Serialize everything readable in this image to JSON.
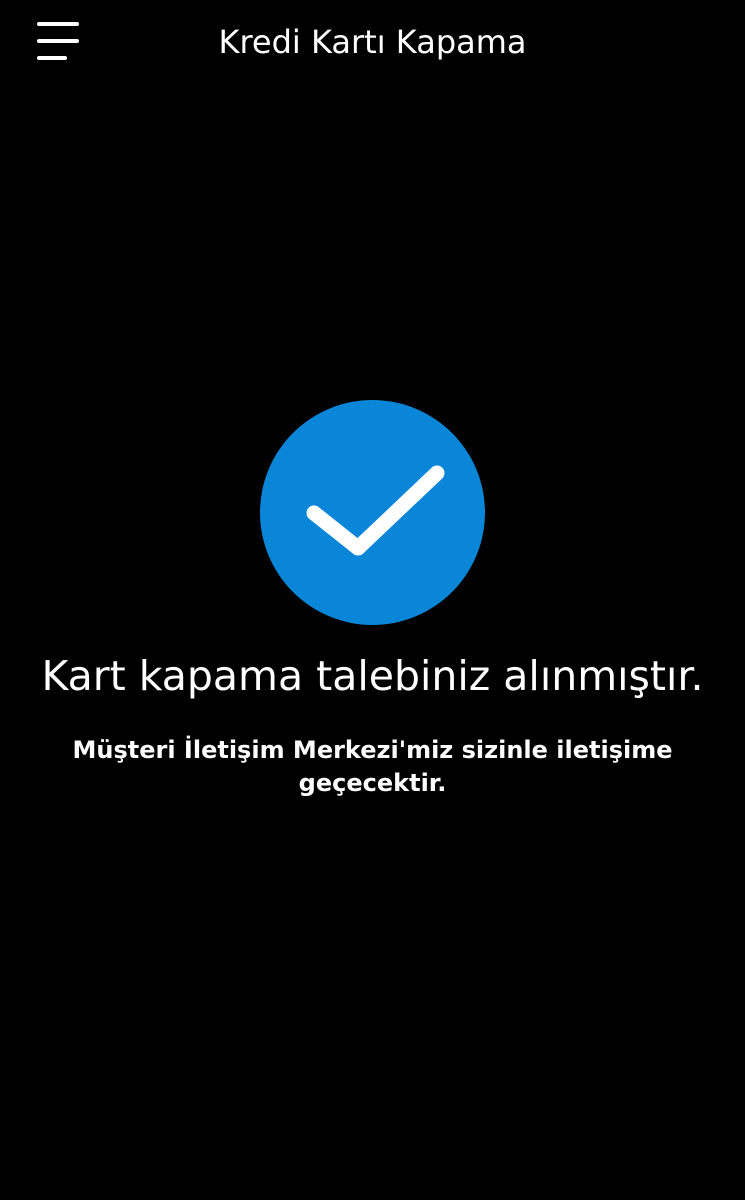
{
  "header": {
    "title": "Kredi Kartı Kapama",
    "menu_icon": "hamburger-menu-icon"
  },
  "result": {
    "status_icon": "check-icon",
    "accent_color": "#0a86d8",
    "title": "Kart kapama talebiniz alınmıştır.",
    "message": "Müşteri İletişim Merkezi'miz sizinle iletişime geçecektir."
  }
}
